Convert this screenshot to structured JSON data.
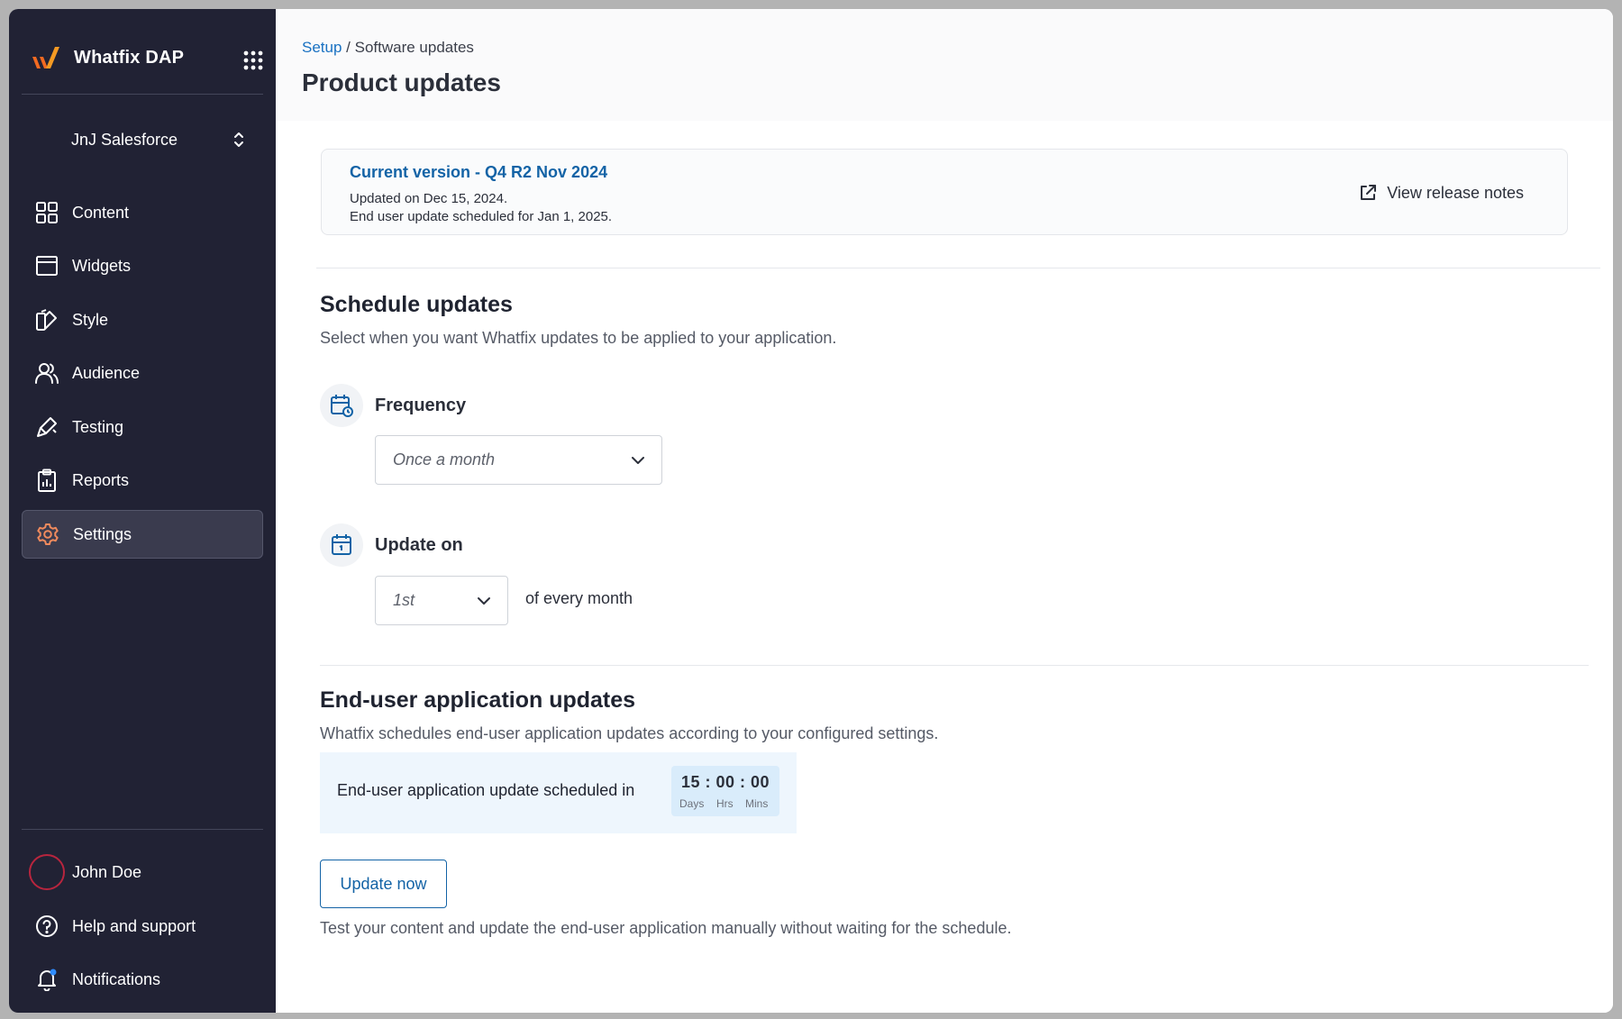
{
  "sidebar": {
    "brand_name": "Whatfix DAP",
    "account": "JnJ Salesforce",
    "nav": [
      {
        "label": "Content",
        "icon": "grid-icon"
      },
      {
        "label": "Widgets",
        "icon": "window-icon"
      },
      {
        "label": "Style",
        "icon": "palette-icon"
      },
      {
        "label": "Audience",
        "icon": "users-icon"
      },
      {
        "label": "Testing",
        "icon": "brush-icon"
      },
      {
        "label": "Reports",
        "icon": "clipboard-icon"
      },
      {
        "label": "Settings",
        "icon": "gear-icon",
        "active": true
      }
    ],
    "user_name": "John Doe",
    "help": "Help and support",
    "notifications": "Notifications"
  },
  "breadcrumb": {
    "link": "Setup",
    "separator": " / ",
    "current": "Software updates"
  },
  "page_title": "Product updates",
  "version": {
    "title": "Current version - Q4 R2 Nov 2024",
    "updated": "Updated on Dec 15, 2024.",
    "scheduled": "End user update scheduled for Jan 1, 2025.",
    "release_notes": "View release notes"
  },
  "schedule": {
    "title": "Schedule updates",
    "description": "Select when you want Whatfix updates to be applied to your application.",
    "frequency_label": "Frequency",
    "frequency_value": "Once a month",
    "update_on_label": "Update on",
    "update_on_value": "1st",
    "update_on_suffix": "of every month"
  },
  "end_user": {
    "title": "End-user application updates",
    "description": "Whatfix schedules end-user application updates according to your configured settings.",
    "scheduled_text": "End-user application update scheduled in",
    "timer": "15 : 00 : 00",
    "units": [
      "Days",
      "Hrs",
      "Mins"
    ],
    "update_button": "Update now",
    "footer_note": "Test your content and update the end-user application manually without waiting for the schedule."
  },
  "colors": {
    "sidebar_bg": "#212234",
    "accent": "#1363a6",
    "brand_orange": "#f26a21",
    "settings_icon": "#f08a5d",
    "notification_dot": "#2f8cff"
  }
}
